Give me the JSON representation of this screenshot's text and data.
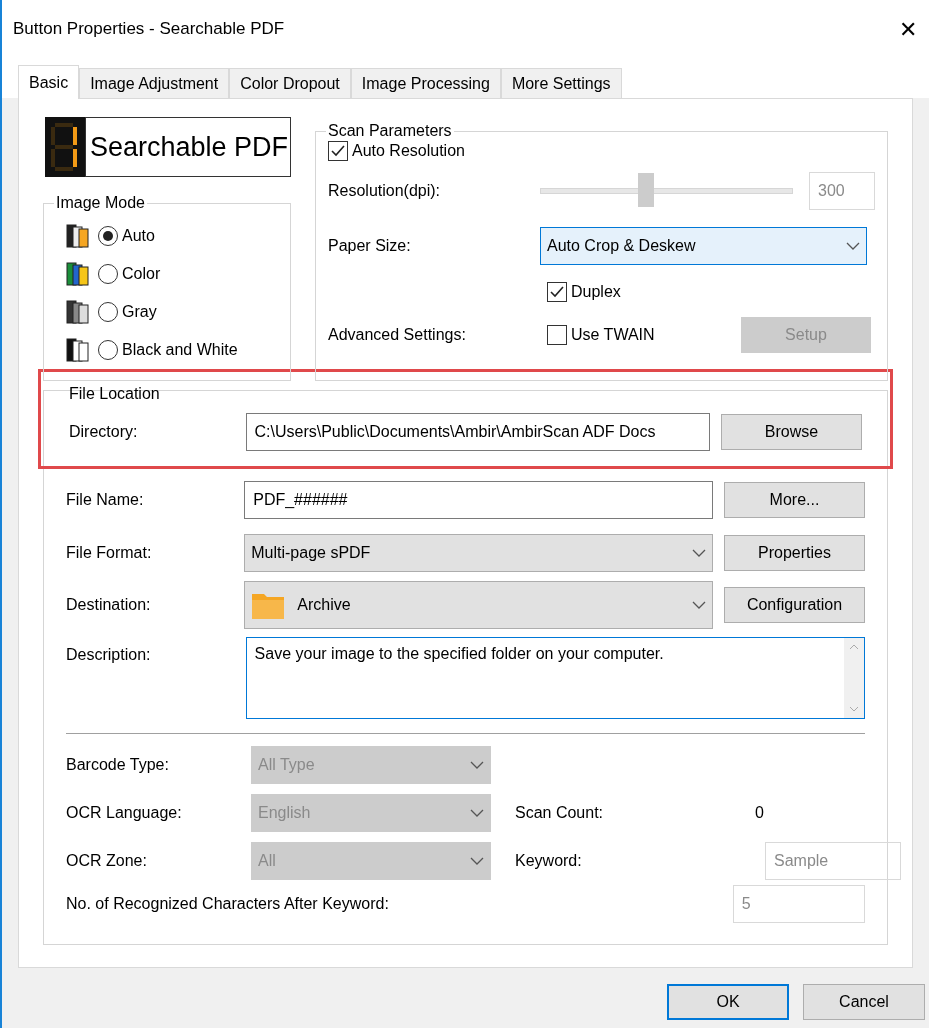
{
  "window": {
    "title": "Button Properties - Searchable PDF",
    "close": "✕"
  },
  "tabs": [
    {
      "label": "Basic",
      "selected": true
    },
    {
      "label": "Image Adjustment",
      "selected": false
    },
    {
      "label": "Color Dropout",
      "selected": false
    },
    {
      "label": "Image Processing",
      "selected": false
    },
    {
      "label": "More Settings",
      "selected": false
    }
  ],
  "button_name": "Searchable PDF",
  "image_mode": {
    "title": "Image Mode",
    "options": [
      {
        "kind": "auto",
        "label": "Auto",
        "selected": true
      },
      {
        "kind": "color",
        "label": "Color",
        "selected": false
      },
      {
        "kind": "gray",
        "label": "Gray",
        "selected": false
      },
      {
        "kind": "bw",
        "label": "Black and White",
        "selected": false
      }
    ]
  },
  "scan_parameters": {
    "title": "Scan Parameters",
    "auto_resolution": {
      "label": "Auto Resolution",
      "checked": true
    },
    "resolution": {
      "label": "Resolution(dpi):",
      "level": 0.42,
      "value": "300",
      "disabled": true
    },
    "paper_size": {
      "label": "Paper Size:",
      "value": "Auto Crop & Deskew"
    },
    "duplex": {
      "label": "Duplex",
      "checked": true
    },
    "advanced": {
      "label": "Advanced Settings:",
      "use_twain": {
        "label": "Use TWAIN",
        "checked": false
      },
      "setup": {
        "label": "Setup",
        "disabled": true
      }
    }
  },
  "file_location": {
    "title": "File Location",
    "highlighted": true,
    "directory": {
      "label": "Directory:",
      "value": "C:\\Users\\Public\\Documents\\Ambir\\AmbirScan ADF Docs",
      "button": "Browse"
    }
  },
  "file_name": {
    "label": "File Name:",
    "value": "PDF_######",
    "button": "More..."
  },
  "file_format": {
    "label": "File Format:",
    "value": "Multi-page sPDF",
    "button": "Properties"
  },
  "destination": {
    "label": "Destination:",
    "value": "Archive",
    "button": "Configuration"
  },
  "description": {
    "label": "Description:",
    "value": "Save your image to the specified folder on your computer."
  },
  "barcode_type": {
    "label": "Barcode Type:",
    "value": "All Type",
    "disabled": true
  },
  "ocr_language": {
    "label": "OCR Language:",
    "value": "English",
    "disabled": true
  },
  "ocr_zone": {
    "label": "OCR Zone:",
    "value": "All",
    "disabled": true
  },
  "scan_count": {
    "label": "Scan Count:",
    "value": "0"
  },
  "keyword": {
    "label": "Keyword:",
    "value": "Sample",
    "disabled": true
  },
  "recognized_chars": {
    "label": "No. of Recognized Characters After Keyword:",
    "value": "5",
    "disabled": true
  },
  "buttons": [
    {
      "label": "OK",
      "default": true
    },
    {
      "label": "Cancel",
      "default": false
    }
  ]
}
